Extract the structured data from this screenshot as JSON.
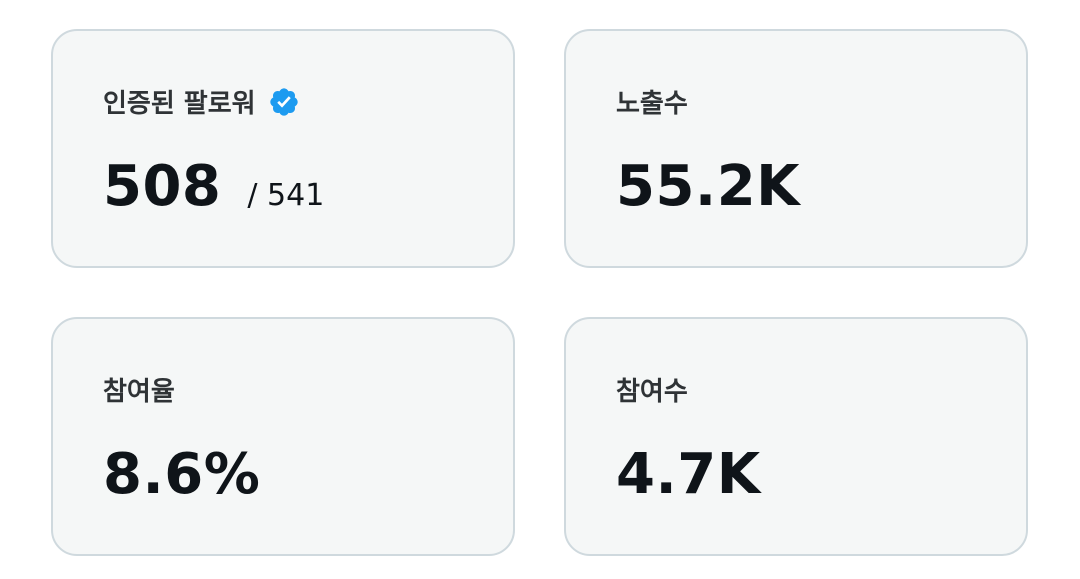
{
  "stats": {
    "verified_followers": {
      "label": "인증된 팔로워",
      "value": "508",
      "total": "/ 541",
      "badge_icon": "verified-badge-icon",
      "badge_color": "#1d9bf0"
    },
    "impressions": {
      "label": "노출수",
      "value": "55.2K"
    },
    "engagement_rate": {
      "label": "참여율",
      "value": "8.6%"
    },
    "engagements": {
      "label": "참여수",
      "value": "4.7K"
    }
  },
  "colors": {
    "card_background": "#f5f7f7",
    "card_border": "#cfd9de",
    "label_text": "#2f3336",
    "value_text": "#0f1419"
  }
}
